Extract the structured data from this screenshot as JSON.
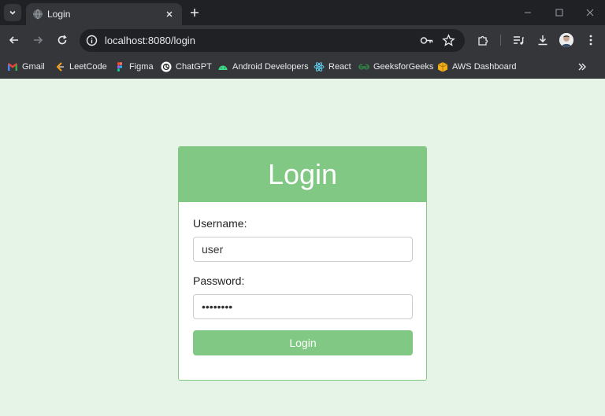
{
  "browser": {
    "tab_title": "Login",
    "url": "localhost:8080/login",
    "bookmarks": [
      {
        "label": "Gmail",
        "icon": "gmail-icon"
      },
      {
        "label": "LeetCode",
        "icon": "leetcode-icon"
      },
      {
        "label": "Figma",
        "icon": "figma-icon"
      },
      {
        "label": "ChatGPT",
        "icon": "chatgpt-icon"
      },
      {
        "label": "Android Developers",
        "icon": "android-icon"
      },
      {
        "label": "React",
        "icon": "react-icon"
      },
      {
        "label": "GeeksforGeeks",
        "icon": "geeksforgeeks-icon"
      },
      {
        "label": "AWS Dashboard",
        "icon": "aws-icon"
      }
    ]
  },
  "login": {
    "title": "Login",
    "username_label": "Username:",
    "username_value": "user",
    "password_label": "Password:",
    "password_value": "password",
    "submit_label": "Login"
  },
  "colors": {
    "accent": "#80c883",
    "page_background": "#e6f4e7",
    "chrome_dark": "#202124",
    "chrome_toolbar": "#35363a"
  }
}
